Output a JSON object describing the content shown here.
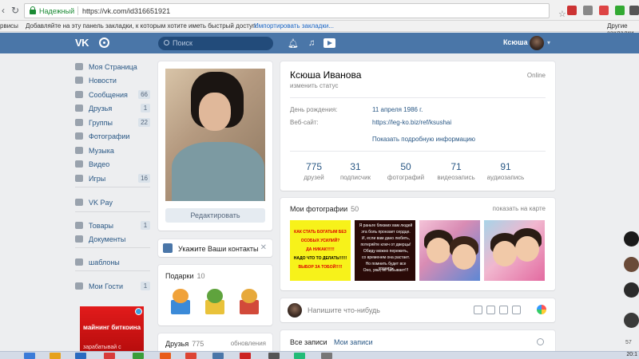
{
  "browser": {
    "secure_label": "Надежный",
    "url": "https://vk.com/id316651921",
    "bookmarks": {
      "apps": "рвисы",
      "hint": "Добавляйте на эту панель закладки, к которым хотите иметь быстрый доступ.",
      "import": "Импортировать закладки...",
      "other": "Другие закладки"
    }
  },
  "header": {
    "logo": "VK",
    "search_placeholder": "Поиск",
    "user_name": "Ксюша"
  },
  "menu": [
    {
      "label": "Моя Страница",
      "count": "",
      "icon": "home-icon"
    },
    {
      "label": "Новости",
      "count": "",
      "icon": "news-icon"
    },
    {
      "label": "Сообщения",
      "count": "66",
      "icon": "messages-icon"
    },
    {
      "label": "Друзья",
      "count": "1",
      "icon": "friends-icon"
    },
    {
      "label": "Группы",
      "count": "22",
      "icon": "groups-icon"
    },
    {
      "label": "Фотографии",
      "count": "",
      "icon": "photos-icon"
    },
    {
      "label": "Музыка",
      "count": "",
      "icon": "music-icon"
    },
    {
      "label": "Видео",
      "count": "",
      "icon": "video-icon"
    },
    {
      "label": "Игры",
      "count": "16",
      "icon": "games-icon"
    },
    {
      "label": "VK Pay",
      "count": "",
      "icon": "vkpay-icon"
    },
    {
      "label": "Товары",
      "count": "1",
      "icon": "goods-icon"
    },
    {
      "label": "Документы",
      "count": "",
      "icon": "documents-icon"
    },
    {
      "label": "шаблоны",
      "count": "",
      "icon": "templates-icon"
    },
    {
      "label": "Мои Гости",
      "count": "1",
      "icon": "guests-icon"
    }
  ],
  "ad": {
    "title": "майнинг биткоина",
    "subtitle": "зарабатывай с легкостью"
  },
  "avatar_card": {
    "edit_label": "Редактировать"
  },
  "contacts": {
    "label": "Укажите Ваши контакты"
  },
  "gifts": {
    "title": "Подарки",
    "count": "10"
  },
  "friends": {
    "title": "Друзья",
    "count": "775",
    "updates": "обновления"
  },
  "profile": {
    "name": "Ксюша Иванова",
    "status": "изменить статус",
    "online": "Online",
    "birthday_label": "День рождения:",
    "birthday_value": "11 апреля 1986 г.",
    "website_label": "Веб-сайт:",
    "website_value": "https://leg-ko.biz/ref/ksushai",
    "more_info": "Показать подробную информацию",
    "stats": [
      {
        "num": "775",
        "label": "друзей"
      },
      {
        "num": "31",
        "label": "подписчик"
      },
      {
        "num": "50",
        "label": "фотографий"
      },
      {
        "num": "71",
        "label": "видеозапись"
      },
      {
        "num": "91",
        "label": "аудиозапись"
      }
    ]
  },
  "photos": {
    "title": "Мои фотографии",
    "count": "50",
    "map_link": "показать на карте",
    "thumb1_lines": [
      "КАК СТАТЬ БОГАТЫМ БЕЗ",
      "ОСОБЫХ УСИЛИЙ?",
      "ДА НИКАК!!!!!!",
      "НАДО ЧТО ТО ДЕЛАТЬ!!!!!!",
      "ВЫБОР ЗА ТОБОЙ!!!!!"
    ],
    "thumb2_lines": [
      "Я раньте близких вам людей",
      "эта боль пронзает сердце.",
      "И, если вам дано любить,",
      "потеряйте ключ от дверцы!",
      "Обиду можно пережить,",
      "со временем она растает.",
      "Но помнить будет все хранить",
      "Оно, увы, не забывает!!!"
    ]
  },
  "post": {
    "placeholder": "Напишите что-нибудь"
  },
  "wall": {
    "tab_all": "Все записи",
    "tab_mine": "Мои записи"
  },
  "side": {
    "badge": "57"
  },
  "taskbar": {
    "clock": "20:1"
  },
  "colors": {
    "vk_blue": "#4a76a8",
    "link": "#2a5885",
    "page_bg": "#edeef0"
  }
}
